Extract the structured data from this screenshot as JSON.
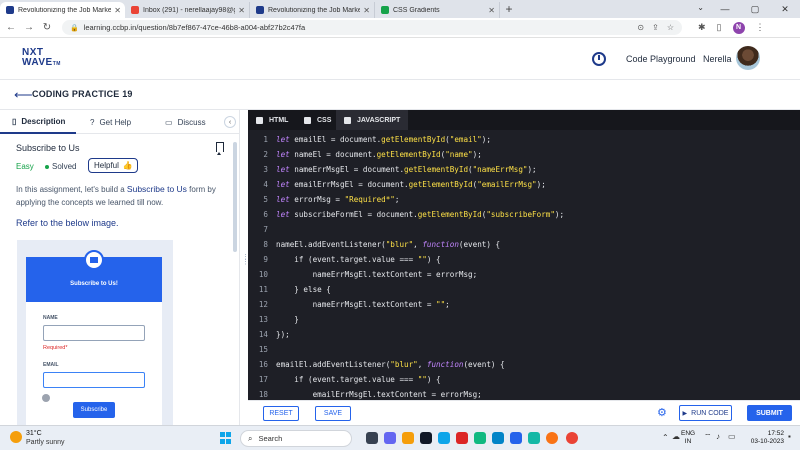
{
  "browser": {
    "tabs": [
      {
        "title": "Revolutionizing the Job Market",
        "active": true
      },
      {
        "title": "Inbox (291) - nerellaajay98@gm",
        "active": false
      },
      {
        "title": "Revolutionizing the Job Market",
        "active": false
      },
      {
        "title": "CSS Gradients",
        "active": false
      }
    ],
    "url": "learning.ccbp.in/question/8b7ef867-47ce-46b8-a004-abf27b2c47fa",
    "profile_initial": "N"
  },
  "header": {
    "logo_line1": "NXT",
    "logo_line2": "WAVE",
    "logo_tm": "TM",
    "code_playground": "Code Playground",
    "username": "Nerella"
  },
  "title_bar": {
    "title": "CODING PRACTICE 19"
  },
  "left_panel": {
    "tabs": [
      "Description",
      "Get Help",
      "Discuss"
    ],
    "question_title": "Subscribe to Us",
    "difficulty": "Easy",
    "status": "Solved",
    "helpful_label": "Helpful",
    "desc_part1": "In this assignment, let's build a ",
    "desc_highlight": "Subscribe to Us",
    "desc_part2": " form by applying the concepts we learned till now.",
    "refer_text": "Refer to the below image.",
    "preview": {
      "heading": "Subscribe to Us!",
      "name_label": "NAME",
      "required_text": "Required*",
      "email_label": "EMAIL",
      "submit_label": "Subscribe"
    }
  },
  "editor": {
    "tabs": [
      "HTML",
      "CSS",
      "JAVASCRIPT"
    ],
    "active_tab": "JAVASCRIPT",
    "lines": [
      {
        "n": "1",
        "parts": [
          [
            "kw",
            "let"
          ],
          [
            "",
            " emailEl = document."
          ],
          [
            "fn",
            "getElementById"
          ],
          [
            "",
            "("
          ],
          [
            "str",
            "\"email\""
          ],
          [
            "",
            ");"
          ]
        ]
      },
      {
        "n": "2",
        "parts": [
          [
            "kw",
            "let"
          ],
          [
            "",
            " nameEl = document."
          ],
          [
            "fn",
            "getElementById"
          ],
          [
            "",
            "("
          ],
          [
            "str",
            "\"name\""
          ],
          [
            "",
            ");"
          ]
        ]
      },
      {
        "n": "3",
        "parts": [
          [
            "kw",
            "let"
          ],
          [
            "",
            " nameErrMsgEl = document."
          ],
          [
            "fn",
            "getElementById"
          ],
          [
            "",
            "("
          ],
          [
            "str",
            "\"nameErrMsg\""
          ],
          [
            "",
            ");"
          ]
        ]
      },
      {
        "n": "4",
        "parts": [
          [
            "kw",
            "let"
          ],
          [
            "",
            " emailErrMsgEl = document."
          ],
          [
            "fn",
            "getElementById"
          ],
          [
            "",
            "("
          ],
          [
            "str",
            "\"emailErrMsg\""
          ],
          [
            "",
            ");"
          ]
        ]
      },
      {
        "n": "5",
        "parts": [
          [
            "kw",
            "let"
          ],
          [
            "",
            " errorMsg = "
          ],
          [
            "str",
            "\"Required*\""
          ],
          [
            "",
            ";"
          ]
        ]
      },
      {
        "n": "6",
        "parts": [
          [
            "kw",
            "let"
          ],
          [
            "",
            " subscribeFormEl = document."
          ],
          [
            "fn",
            "getElementById"
          ],
          [
            "",
            "("
          ],
          [
            "str",
            "\"subscribeForm\""
          ],
          [
            "",
            ");"
          ]
        ]
      },
      {
        "n": "7",
        "parts": [
          [
            "",
            ""
          ]
        ]
      },
      {
        "n": "8",
        "parts": [
          [
            "",
            "nameEl.addEventListener("
          ],
          [
            "str",
            "\"blur\""
          ],
          [
            "",
            ", "
          ],
          [
            "kw",
            "function"
          ],
          [
            "",
            "(event) {"
          ]
        ]
      },
      {
        "n": "9",
        "parts": [
          [
            "",
            "    if (event.target.value === "
          ],
          [
            "str",
            "\"\""
          ],
          [
            "",
            ") {"
          ]
        ]
      },
      {
        "n": "10",
        "parts": [
          [
            "",
            "        nameErrMsgEl.textContent = errorMsg;"
          ]
        ]
      },
      {
        "n": "11",
        "parts": [
          [
            "",
            "    } else {"
          ]
        ]
      },
      {
        "n": "12",
        "parts": [
          [
            "",
            "        nameErrMsgEl.textContent = "
          ],
          [
            "str",
            "\"\""
          ],
          [
            "",
            ";"
          ]
        ]
      },
      {
        "n": "13",
        "parts": [
          [
            "",
            "    }"
          ]
        ]
      },
      {
        "n": "14",
        "parts": [
          [
            "",
            "});"
          ]
        ]
      },
      {
        "n": "15",
        "parts": [
          [
            "",
            ""
          ]
        ]
      },
      {
        "n": "16",
        "parts": [
          [
            "",
            "emailEl.addEventListener("
          ],
          [
            "str",
            "\"blur\""
          ],
          [
            "",
            ", "
          ],
          [
            "kw",
            "function"
          ],
          [
            "",
            "(event) {"
          ]
        ]
      },
      {
        "n": "17",
        "parts": [
          [
            "",
            "    if (event.target.value === "
          ],
          [
            "str",
            "\"\""
          ],
          [
            "",
            ") {"
          ]
        ]
      },
      {
        "n": "18",
        "parts": [
          [
            "",
            "        emailErrMsgEl.textContent = errorMsg;"
          ]
        ]
      }
    ]
  },
  "actions": {
    "reset": "RESET",
    "save": "SAVE",
    "run_code": "RUN CODE",
    "submit": "SUBMIT"
  },
  "taskbar": {
    "temperature": "31°C",
    "weather": "Partly sunny",
    "search_placeholder": "Search",
    "lang_line1": "ENG",
    "lang_line2": "IN",
    "time": "17:52",
    "date": "03-10-2023"
  }
}
